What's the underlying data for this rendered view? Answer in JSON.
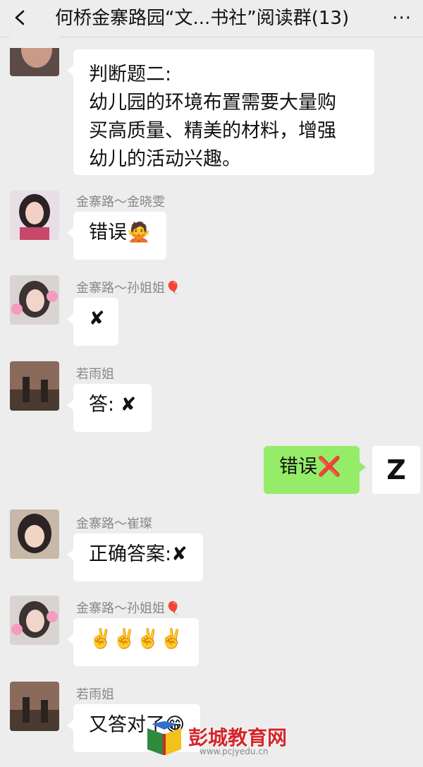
{
  "header": {
    "title": "何桥金寨路园“文...书社”阅读群(13)",
    "more_label": "···"
  },
  "messages": [
    {
      "lines": [
        "判断题二:",
        "幼儿园的环境布置需要大量购",
        "买高质量、精美的材料，增强",
        "幼儿的活动兴趣。"
      ]
    },
    {
      "sender": "金寨路～金晓雯",
      "text": "错误",
      "emoji": "🙅"
    },
    {
      "sender": "金寨路～孙姐姐",
      "sender_emoji": "🎈",
      "text": "✘"
    },
    {
      "sender": "若雨姐",
      "text": "答: ",
      "mark": "✘"
    },
    {
      "text": "错误",
      "mark": "❌",
      "avatar_letter": "Z"
    },
    {
      "sender": "金寨路～崔璨",
      "text": "正确答案:",
      "mark": "✘"
    },
    {
      "sender": "金寨路～孙姐姐",
      "sender_emoji": "🎈",
      "text": "✌️✌️✌️✌️"
    },
    {
      "sender": "若雨姐",
      "text": "又答对了",
      "emoji": "😁"
    }
  ],
  "watermark": {
    "text": "彭城教育网",
    "url": "www.pcjyedu.cn"
  },
  "colors": {
    "background": "#ededed",
    "self_bubble": "#95ec69",
    "other_bubble": "#ffffff",
    "watermark": "#d3262b"
  }
}
